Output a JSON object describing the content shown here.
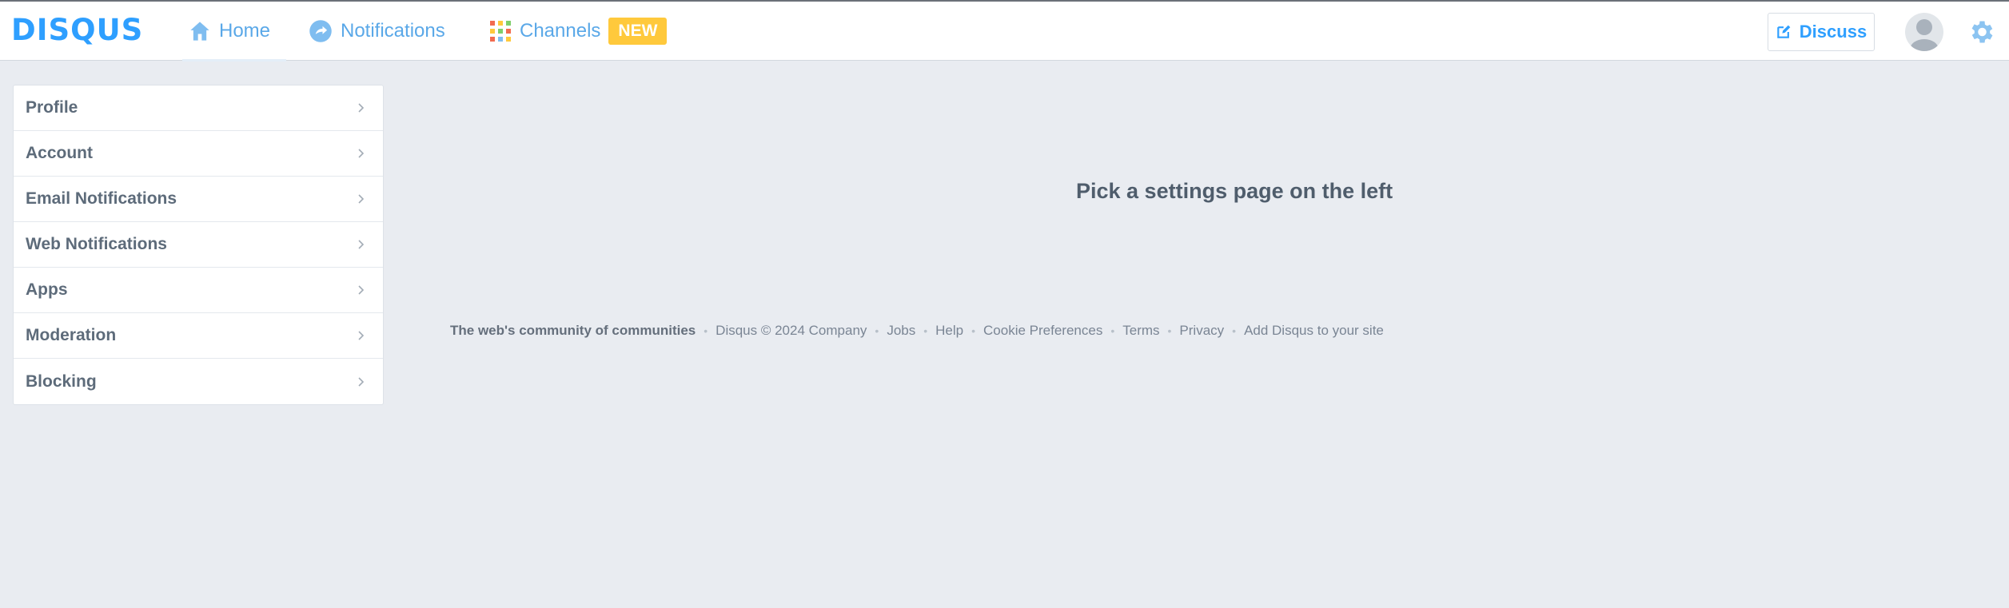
{
  "brand": {
    "logo_text": "DISQUS",
    "accent": "#2e9fff"
  },
  "nav": {
    "home_label": "Home",
    "notifications_label": "Notifications",
    "channels_label": "Channels",
    "channels_badge": "NEW",
    "icons": [
      "home-icon",
      "notifications-icon",
      "channels-grid-icon"
    ]
  },
  "header_right": {
    "discuss_label": "Discuss",
    "discuss_icon": "edit-icon",
    "avatar_icon": "user-avatar",
    "settings_icon": "gear-icon"
  },
  "sidebar": {
    "items": [
      {
        "label": "Profile"
      },
      {
        "label": "Account"
      },
      {
        "label": "Email Notifications"
      },
      {
        "label": "Web Notifications"
      },
      {
        "label": "Apps"
      },
      {
        "label": "Moderation"
      },
      {
        "label": "Blocking"
      }
    ]
  },
  "main": {
    "message": "Pick a settings page on the left"
  },
  "footer": {
    "tagline": "The web's community of communities",
    "links": [
      "Disqus © 2024 Company",
      "Jobs",
      "Help",
      "Cookie Preferences",
      "Terms",
      "Privacy",
      "Add Disqus to your site"
    ]
  },
  "colors": {
    "background": "#e9ecf1",
    "badge": "#ffc93c",
    "link": "#5aa8e8"
  }
}
